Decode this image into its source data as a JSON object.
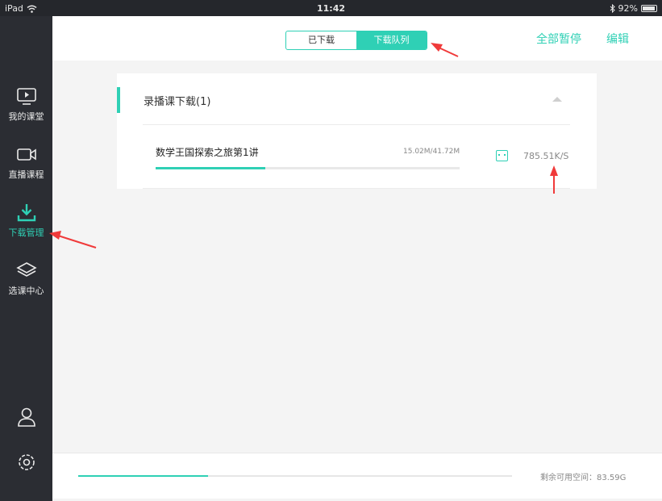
{
  "status": {
    "device": "iPad",
    "time": "11:42",
    "battery": "92%"
  },
  "sidebar": {
    "items": [
      {
        "label": "我的课堂",
        "icon": "monitor-play-icon"
      },
      {
        "label": "直播课程",
        "icon": "video-camera-icon"
      },
      {
        "label": "下载管理",
        "icon": "download-icon",
        "active": true
      },
      {
        "label": "选课中心",
        "icon": "layers-icon"
      }
    ],
    "bottom_icons": [
      "user-icon",
      "gear-icon"
    ]
  },
  "header": {
    "tabs": [
      {
        "label": "已下载"
      },
      {
        "label": "下载队列",
        "selected": true
      }
    ],
    "actions": {
      "pause_all": "全部暂停",
      "edit": "编辑"
    }
  },
  "queue": {
    "section_title": "录播课下载(1)",
    "items": [
      {
        "title": "数学王国探索之旅第1讲",
        "size": "15.02M/41.72M",
        "speed": "785.51K/S",
        "progress": 0.36
      }
    ]
  },
  "footer": {
    "storage": "剩余可用空间：83.59G",
    "storage_used_fraction": 0.3
  },
  "colors": {
    "accent": "#2fd0b5",
    "sidebar": "#2b2d33",
    "annotation": "#f03a3a"
  }
}
